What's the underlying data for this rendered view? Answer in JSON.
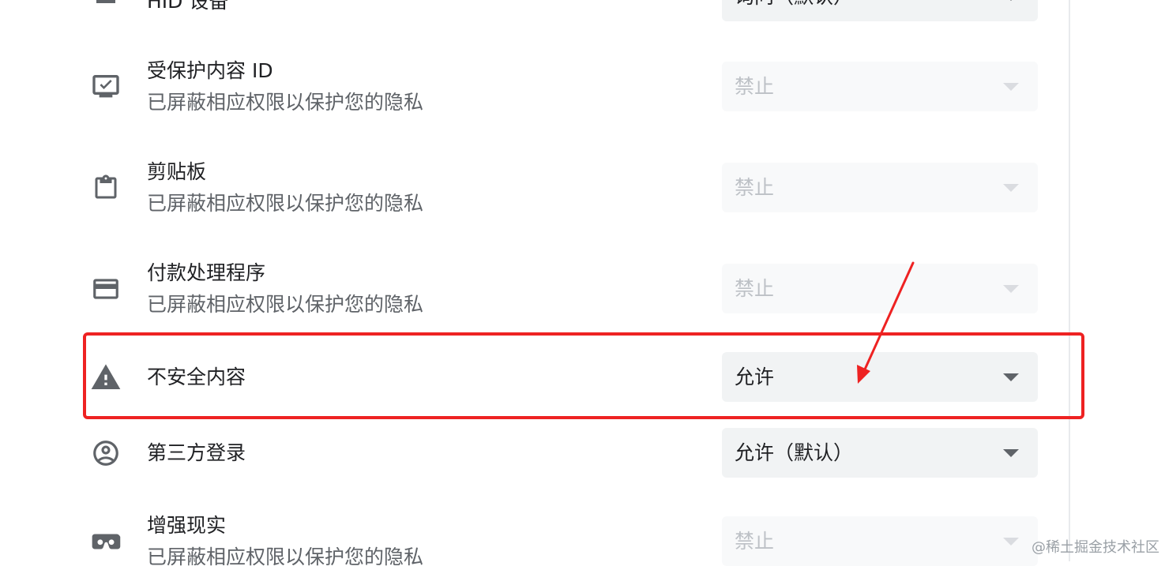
{
  "rows": [
    {
      "icon": "usb-device-icon",
      "title": "HID 设备",
      "select": "询问（默认）",
      "disabled": false
    },
    {
      "icon": "protected-content-icon",
      "title": "受保护内容 ID",
      "subtitle": "已屏蔽相应权限以保护您的隐私",
      "select": "禁止",
      "disabled": true
    },
    {
      "icon": "clipboard-icon",
      "title": "剪贴板",
      "subtitle": "已屏蔽相应权限以保护您的隐私",
      "select": "禁止",
      "disabled": true
    },
    {
      "icon": "credit-card-icon",
      "title": "付款处理程序",
      "subtitle": "已屏蔽相应权限以保护您的隐私",
      "select": "禁止",
      "disabled": true
    },
    {
      "icon": "warning-icon",
      "title": "不安全内容",
      "select": "允许",
      "disabled": false
    },
    {
      "icon": "account-circle-icon",
      "title": "第三方登录",
      "select": "允许（默认）",
      "disabled": false
    },
    {
      "icon": "vr-headset-icon",
      "title": "增强现实",
      "subtitle": "已屏蔽相应权限以保护您的隐私",
      "select": "禁止",
      "disabled": true
    }
  ],
  "annotation": {
    "highlight_color": "#ee2222"
  },
  "watermark": "@稀土掘金技术社区"
}
